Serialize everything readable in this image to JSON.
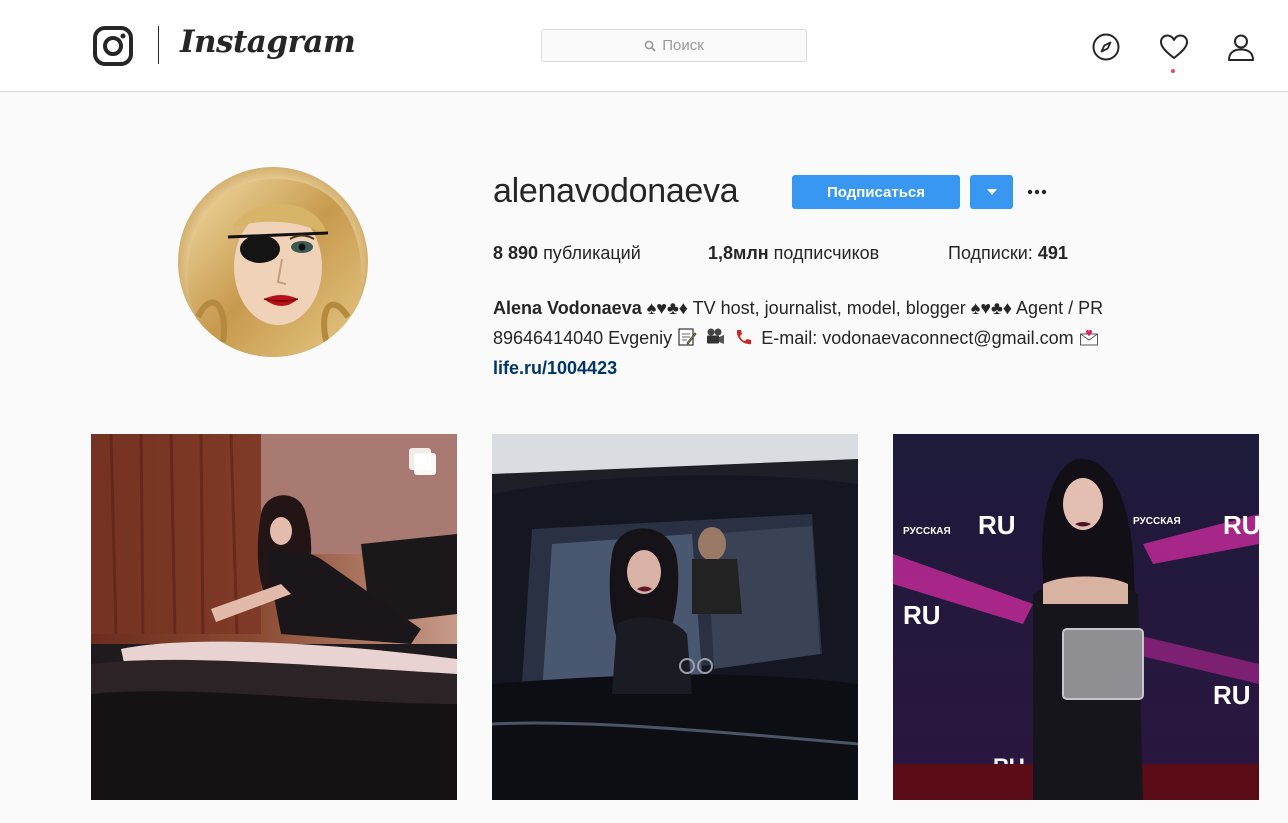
{
  "header": {
    "wordmark": "Instagram",
    "search_placeholder": "Поиск"
  },
  "profile": {
    "username": "alenavodonaeva",
    "follow_label": "Подписаться",
    "posts_count": "8 890",
    "posts_label": "публикаций",
    "followers_count": "1,8млн",
    "followers_label": "подписчиков",
    "following_label": "Подписки:",
    "following_count": "491"
  },
  "bio": {
    "name": "Alena Vodonaeva",
    "line1_rest": "♠♥♣♦ TV host, journalist, model, blogger ♠♥♣♦ Agent / PR",
    "line2": "89646414040 Evgeniy",
    "line2_email": "E-mail: vodonaevaconnect@gmail.com",
    "link": "life.ru/1004423"
  },
  "posts": [
    {
      "alt": "photo",
      "multi": true
    },
    {
      "alt": "photo",
      "multi": false
    },
    {
      "alt": "photo",
      "multi": false
    }
  ],
  "colors": {
    "accent": "#3897f0",
    "link": "#003569",
    "border": "#dbdbdb",
    "background": "#fafafa",
    "notification": "#ed4956"
  }
}
